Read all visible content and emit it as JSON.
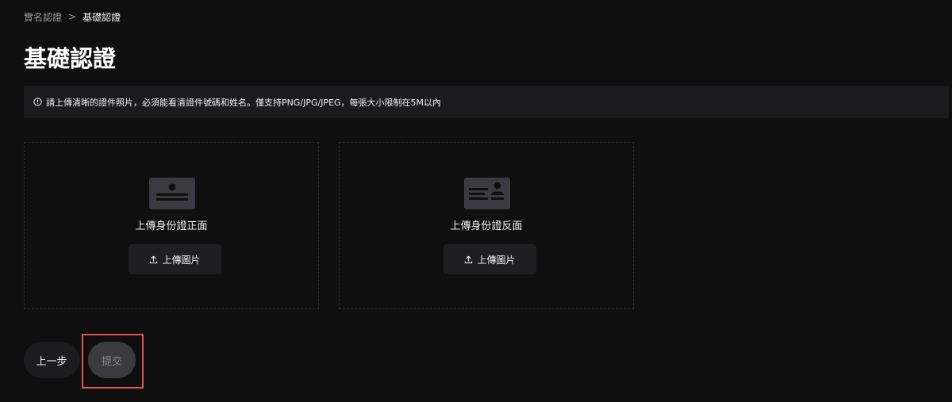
{
  "breadcrumb": {
    "parent": "實名認證",
    "separator": ">",
    "current": "基礎認證"
  },
  "page": {
    "title": "基礎認證"
  },
  "notice": {
    "icon": "info-icon",
    "text": "請上傳清晰的證件照片，必須能看清證件號碼和姓名。僅支持PNG/JPG/JPEG，每張大小限制在5M以內"
  },
  "uploads": [
    {
      "icon": "id-card-front-icon",
      "label": "上傳身份證正面",
      "button_label": "上傳圖片"
    },
    {
      "icon": "id-card-back-icon",
      "label": "上傳身份證反面",
      "button_label": "上傳圖片"
    }
  ],
  "actions": {
    "prev_label": "上一步",
    "submit_label": "提交"
  },
  "colors": {
    "background": "#0f0f10",
    "notice_bg": "#1b1b1d",
    "highlight_border": "#e05252",
    "submit_disabled_bg": "#3b3b3f"
  }
}
